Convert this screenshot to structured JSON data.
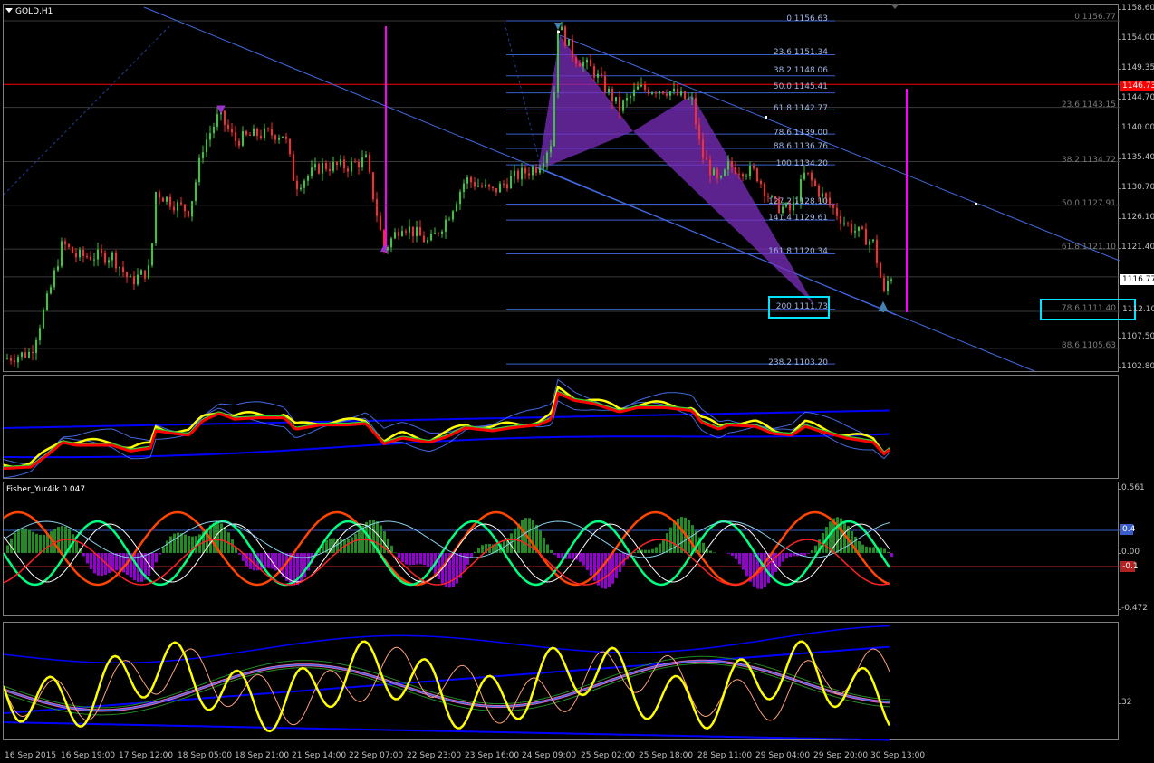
{
  "window": {
    "title": "GOLD,H1"
  },
  "indicator_title": "Fisher_Yur4ik 0.047",
  "price_scale": [
    "1158.60",
    "1154.00",
    "1149.35",
    "1144.70",
    "1140.00",
    "1135.40",
    "1130.70",
    "1126.10",
    "1121.40",
    "1107.50",
    "1102.80"
  ],
  "price_labels": {
    "current_price": "1116.77",
    "red_line_price": "1146.73",
    "boxed_price": "1112.10"
  },
  "indicator2_scale": {
    "top": "0.561",
    "upper_level": "0.4",
    "zero": "0.00",
    "lower_level": "-0.1",
    "bottom": "-0.472"
  },
  "indicator3_scale": {
    "level": "32"
  },
  "time_axis": [
    "16 Sep 2015",
    "16 Sep 19:00",
    "17 Sep 12:00",
    "18 Sep 05:00",
    "18 Sep 21:00",
    "21 Sep 14:00",
    "22 Sep 07:00",
    "22 Sep 23:00",
    "23 Sep 16:00",
    "24 Sep 09:00",
    "25 Sep 02:00",
    "25 Sep 18:00",
    "28 Sep 11:00",
    "29 Sep 04:00",
    "29 Sep 20:00",
    "30 Sep 13:00"
  ],
  "fibo_retracement": [
    {
      "text": "0 1156.63"
    },
    {
      "text": "23.6 1151.34"
    },
    {
      "text": "38.2 1148.06"
    },
    {
      "text": "50.0 1145.41"
    },
    {
      "text": "61.8 1142.77"
    },
    {
      "text": "78.6 1139.00"
    },
    {
      "text": "88.6 1136.76"
    },
    {
      "text": "100 1134.20"
    },
    {
      "text": "127.2 1128.10"
    },
    {
      "text": "141.4 1129.61"
    },
    {
      "text": "161.8 1120.34"
    },
    {
      "text": "200 1111.73"
    },
    {
      "text": "238.2 1103.20"
    }
  ],
  "fibo_right": [
    {
      "text": "0 1156.77"
    },
    {
      "text": "23.6 1143.15"
    },
    {
      "text": "38.2 1134.72"
    },
    {
      "text": "50.0 1127.91"
    },
    {
      "text": "61.8 1121.10"
    },
    {
      "text": "78.6 1111.40"
    },
    {
      "text": "88.6 1105.63"
    }
  ],
  "colors": {
    "background": "#000000",
    "bull_candle": "#32cd32",
    "bear_candle": "#ff2a2a",
    "fib_line": "#3a5fcd",
    "trend_line": "#4169e1",
    "pattern_fill": "#7b2fbe",
    "highlight_box": "#00e5ff",
    "magenta_line": "#ff00ff",
    "red_level": "#ff0000"
  }
}
